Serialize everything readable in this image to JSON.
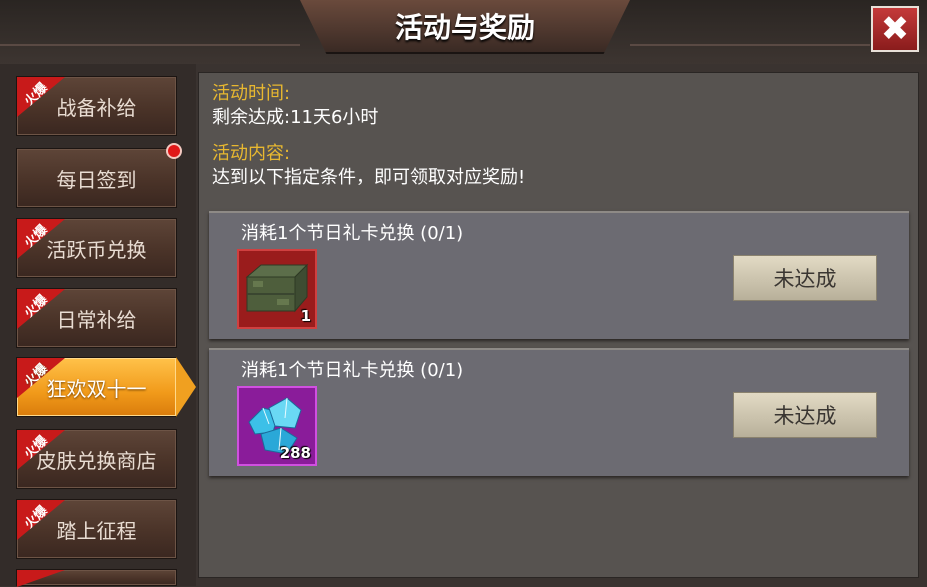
{
  "header": {
    "title": "活动与奖励",
    "close_label": "✖"
  },
  "sidebar": {
    "hot_label": "火爆",
    "items": [
      {
        "label": "战备补给",
        "hot": true
      },
      {
        "label": "每日签到",
        "hot": false
      },
      {
        "label": "活跃币兑换",
        "hot": true
      },
      {
        "label": "日常补给",
        "hot": true
      },
      {
        "label": "狂欢双十一",
        "hot": true
      },
      {
        "label": "皮肤兑换商店",
        "hot": true
      },
      {
        "label": "踏上征程",
        "hot": true
      }
    ]
  },
  "info": {
    "time_label": "活动时间:",
    "time_value": "剩余达成:11天6小时",
    "content_label": "活动内容:",
    "content_value": "达到以下指定条件，即可领取对应奖励!"
  },
  "tasks": [
    {
      "title": "消耗1个节日礼卡兑换  (0/1)",
      "reward_count": "1",
      "status": "未达成"
    },
    {
      "title": "消耗1个节日礼卡兑换  (0/1)",
      "reward_count": "288",
      "status": "未达成"
    }
  ]
}
